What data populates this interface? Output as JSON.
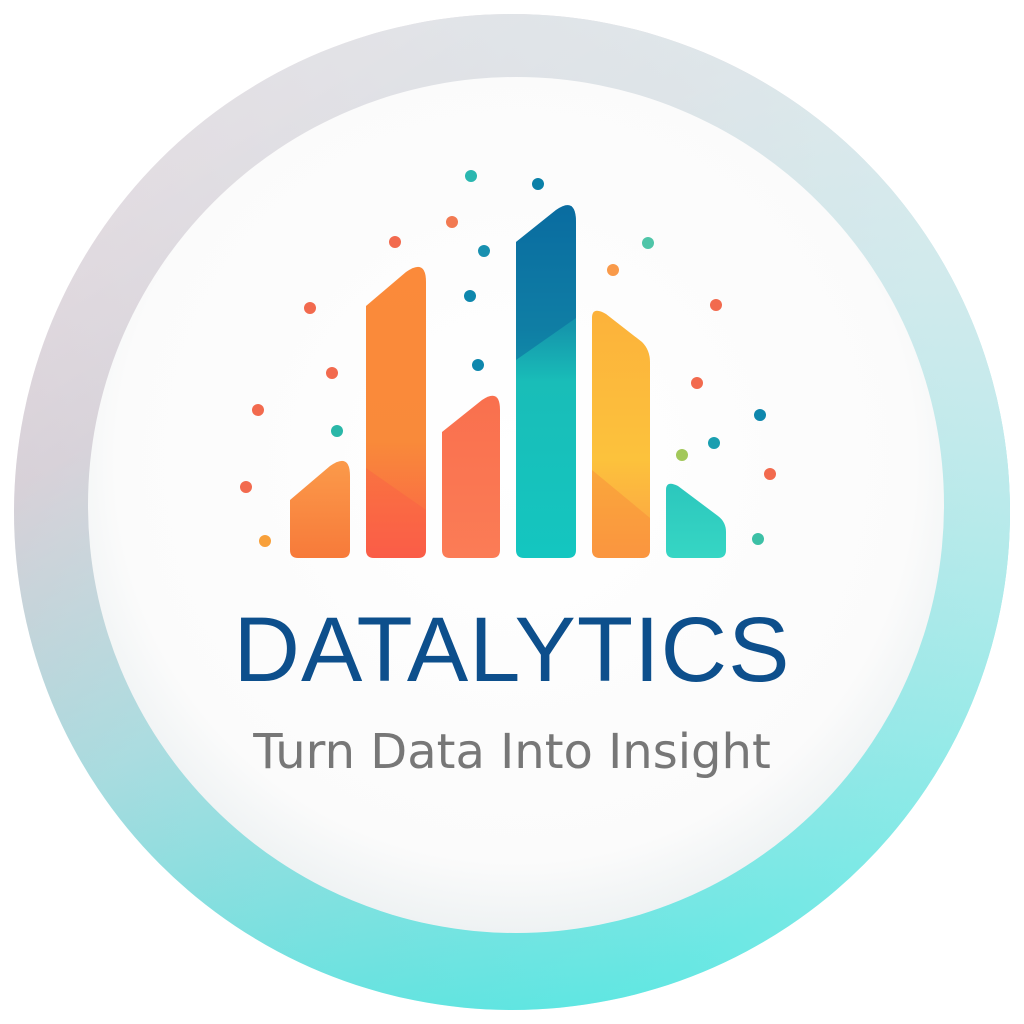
{
  "logo": {
    "brand_name": "DATALYTICS",
    "tagline": "Turn Data Into Insight",
    "icon": "bar-chart-icon",
    "relative_bar_heights": [
      0.27,
      0.83,
      0.46,
      1.0,
      0.7,
      0.21
    ],
    "colors": {
      "brand_text": "#0d4f8c",
      "tagline_text": "#777777",
      "ring_top": "#f0d6dc",
      "ring_bottom": "#2ee3dc",
      "inner_disc": "#fbfbfb",
      "bar_orange": "#f98a3a",
      "bar_coral": "#fa6e52",
      "bar_blue": "#0a7aa6",
      "bar_teal": "#19c4bd",
      "bar_yellow": "#fbbf3b",
      "bar_mint": "#2fcfbf"
    }
  }
}
